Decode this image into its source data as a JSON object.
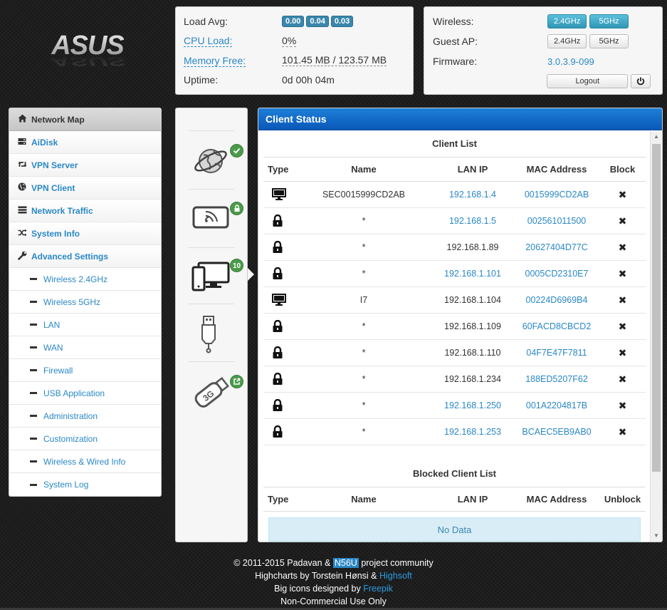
{
  "logo": {
    "text": "ASUS"
  },
  "status": {
    "load_avg_label": "Load Avg:",
    "load_avg": [
      "0.00",
      "0.04",
      "0.03"
    ],
    "cpu_label": "CPU Load:",
    "cpu_value": "0%",
    "mem_label": "Memory Free:",
    "mem_value": "101.45 MB / 123.57 MB",
    "uptime_label": "Uptime:",
    "uptime_value": "0d 00h 04m"
  },
  "wireless": {
    "wireless_label": "Wireless:",
    "guest_label": "Guest AP:",
    "firmware_label": "Firmware:",
    "firmware_value": "3.0.3.9-099",
    "band_24": "2.4GHz",
    "band_5": "5GHz",
    "logout": "Logout",
    "power_icon": "power-icon"
  },
  "menu": {
    "main": [
      {
        "label": "Network Map",
        "icon": "home-icon"
      },
      {
        "label": "AiDisk",
        "icon": "disk-icon"
      },
      {
        "label": "VPN Server",
        "icon": "retweet-icon"
      },
      {
        "label": "VPN Client",
        "icon": "globe-icon"
      },
      {
        "label": "Network Traffic",
        "icon": "tasks-icon"
      },
      {
        "label": "System Info",
        "icon": "random-icon"
      },
      {
        "label": "Advanced Settings",
        "icon": "wrench-icon"
      }
    ],
    "sub": [
      "Wireless 2.4GHz",
      "Wireless 5GHz",
      "LAN",
      "WAN",
      "Firewall",
      "USB Application",
      "Administration",
      "Customization",
      "Wireless & Wired Info",
      "System Log"
    ]
  },
  "icons": {
    "clients_count": "10"
  },
  "client_status": {
    "title": "Client Status",
    "client_list_title": "Client List",
    "headers": [
      "Type",
      "Name",
      "LAN IP",
      "MAC Address",
      "Block"
    ],
    "rows": [
      {
        "type": "pc",
        "name": "SEC0015999CD2AB",
        "ip": "192.168.1.4",
        "ip_link": true,
        "mac": "0015999CD2AB"
      },
      {
        "type": "lock",
        "name": "*",
        "ip": "192.168.1.5",
        "ip_link": true,
        "mac": "002561011500"
      },
      {
        "type": "lock",
        "name": "*",
        "ip": "192.168.1.89",
        "ip_link": false,
        "mac": "20627404D77C"
      },
      {
        "type": "lock",
        "name": "*",
        "ip": "192.168.1.101",
        "ip_link": true,
        "mac": "0005CD2310E7"
      },
      {
        "type": "pc",
        "name": "I7",
        "ip": "192.168.1.104",
        "ip_link": false,
        "mac": "00224D6969B4"
      },
      {
        "type": "lock",
        "name": "*",
        "ip": "192.168.1.109",
        "ip_link": false,
        "mac": "60FACD8CBCD2"
      },
      {
        "type": "lock",
        "name": "*",
        "ip": "192.168.1.110",
        "ip_link": false,
        "mac": "04F7E47F7811"
      },
      {
        "type": "lock",
        "name": "*",
        "ip": "192.168.1.234",
        "ip_link": false,
        "mac": "188ED5207F62"
      },
      {
        "type": "lock",
        "name": "*",
        "ip": "192.168.1.250",
        "ip_link": true,
        "mac": "001A2204817B"
      },
      {
        "type": "lock",
        "name": "*",
        "ip": "192.168.1.253",
        "ip_link": true,
        "mac": "BCAEC5EB9AB0"
      }
    ],
    "blocked_title": "Blocked Client List",
    "blocked_headers": [
      "Type",
      "Name",
      "LAN IP",
      "MAC Address",
      "Unblock"
    ],
    "no_data": "No Data"
  },
  "footer": {
    "line1_pre": "© 2011-2015 Padavan & ",
    "line1_hl": "N56U",
    "line1_post": " project community",
    "line2_pre": "Highcharts by Torstein Hønsi & ",
    "line2_link": "Highsoft",
    "line3_pre": "Big icons designed by ",
    "line3_link": "Freepik",
    "line4": "Non-Commercial Use Only"
  }
}
